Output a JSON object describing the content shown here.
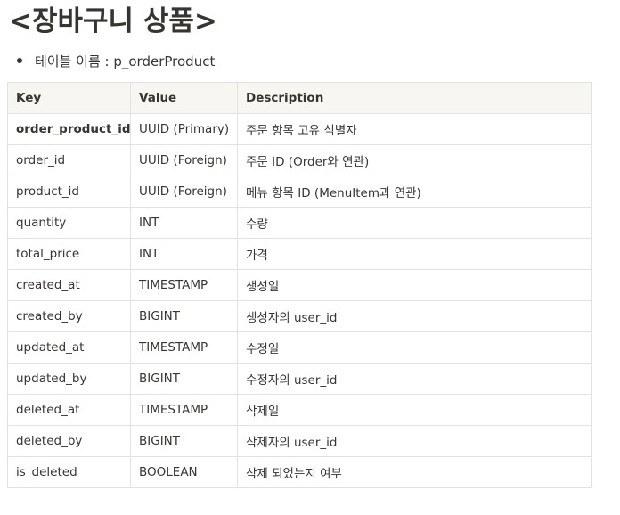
{
  "title": "<장바구니 상품>",
  "bullet": {
    "text": "테이블 이름 : p_orderProduct"
  },
  "table": {
    "headers": {
      "key": "Key",
      "value": "Value",
      "description": "Description"
    },
    "rows": [
      {
        "key": "order_product_id",
        "value": "UUID (Primary)",
        "description": "주문 항목 고유 식별자"
      },
      {
        "key": "order_id",
        "value": "UUID (Foreign)",
        "description": "주문 ID (Order와 연관)"
      },
      {
        "key": "product_id",
        "value": "UUID (Foreign)",
        "description": "메뉴 항목 ID (MenuItem과 연관)"
      },
      {
        "key": "quantity",
        "value": "INT",
        "description": "수량"
      },
      {
        "key": "total_price",
        "value": "INT",
        "description": "가격"
      },
      {
        "key": "created_at",
        "value": "TIMESTAMP",
        "description": "생성일"
      },
      {
        "key": "created_by",
        "value": "BIGINT",
        "description": "생성자의 user_id"
      },
      {
        "key": "updated_at",
        "value": "TIMESTAMP",
        "description": "수정일"
      },
      {
        "key": "updated_by",
        "value": "BIGINT",
        "description": "수정자의 user_id"
      },
      {
        "key": "deleted_at",
        "value": "TIMESTAMP",
        "description": "삭제일"
      },
      {
        "key": "deleted_by",
        "value": "BIGINT",
        "description": "삭제자의 user_id"
      },
      {
        "key": "is_deleted",
        "value": "BOOLEAN",
        "description": "삭제 되었는지 여부"
      }
    ]
  }
}
